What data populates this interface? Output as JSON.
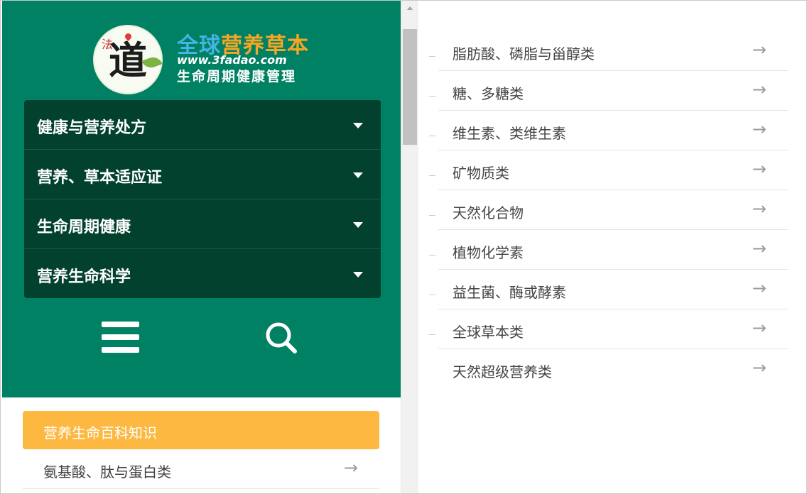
{
  "logo": {
    "mark_char": "道",
    "mark_small": "法",
    "title_part1": "全球",
    "title_part2": "营养草本",
    "url": "www.3fadao.com",
    "slogan": "生命周期健康管理"
  },
  "menu": {
    "items": [
      {
        "label": "健康与营养处方"
      },
      {
        "label": "营养、草本适应证"
      },
      {
        "label": "生命周期健康"
      },
      {
        "label": "营养生命科学"
      }
    ]
  },
  "toolbar": {
    "menu_icon": "hamburger-icon",
    "search_icon": "search-icon"
  },
  "category": {
    "header": "营养生命百科知识",
    "first_item": "氨基酸、肽与蛋白类"
  },
  "right_list": {
    "items": [
      {
        "label": "脂肪酸、磷脂与甾醇类"
      },
      {
        "label": "糖、多糖类"
      },
      {
        "label": "维生素、类维生素"
      },
      {
        "label": "矿物质类"
      },
      {
        "label": "天然化合物"
      },
      {
        "label": "植物化学素"
      },
      {
        "label": "益生菌、酶或酵素"
      },
      {
        "label": "全球草本类"
      },
      {
        "label": "天然超级营养类"
      }
    ]
  },
  "arrow_glyph": "→",
  "colors": {
    "header_green": "#018163",
    "menu_dark_green": "#03412f",
    "category_orange": "#fcb840",
    "text_gray": "#444444"
  }
}
